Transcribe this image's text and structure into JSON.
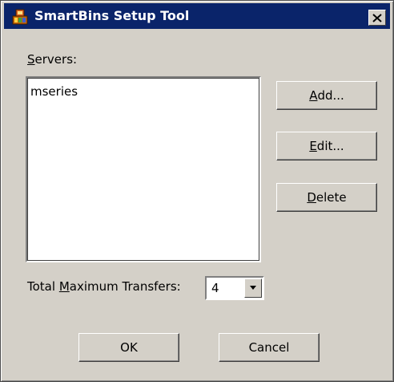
{
  "window": {
    "title": "SmartBins Setup Tool",
    "icon": "smartbins-app-icon",
    "close_icon": "close-icon"
  },
  "servers": {
    "label_prefix": "",
    "label_mnemonic": "S",
    "label_rest": "ervers:",
    "items": [
      "mseries"
    ]
  },
  "buttons": {
    "add": {
      "mnemonic": "A",
      "rest": "dd..."
    },
    "edit": {
      "mnemonic": "E",
      "rest": "dit..."
    },
    "delete": {
      "mnemonic": "D",
      "rest": "elete"
    },
    "ok": "OK",
    "cancel": "Cancel"
  },
  "max_transfers": {
    "label_prefix": "Total ",
    "label_mnemonic": "M",
    "label_rest": "aximum Transfers:",
    "value": "4",
    "dropdown_icon": "chevron-down-icon"
  },
  "colors": {
    "titlebar": "#0a246a",
    "dialog_bg": "#d4d0c8"
  }
}
